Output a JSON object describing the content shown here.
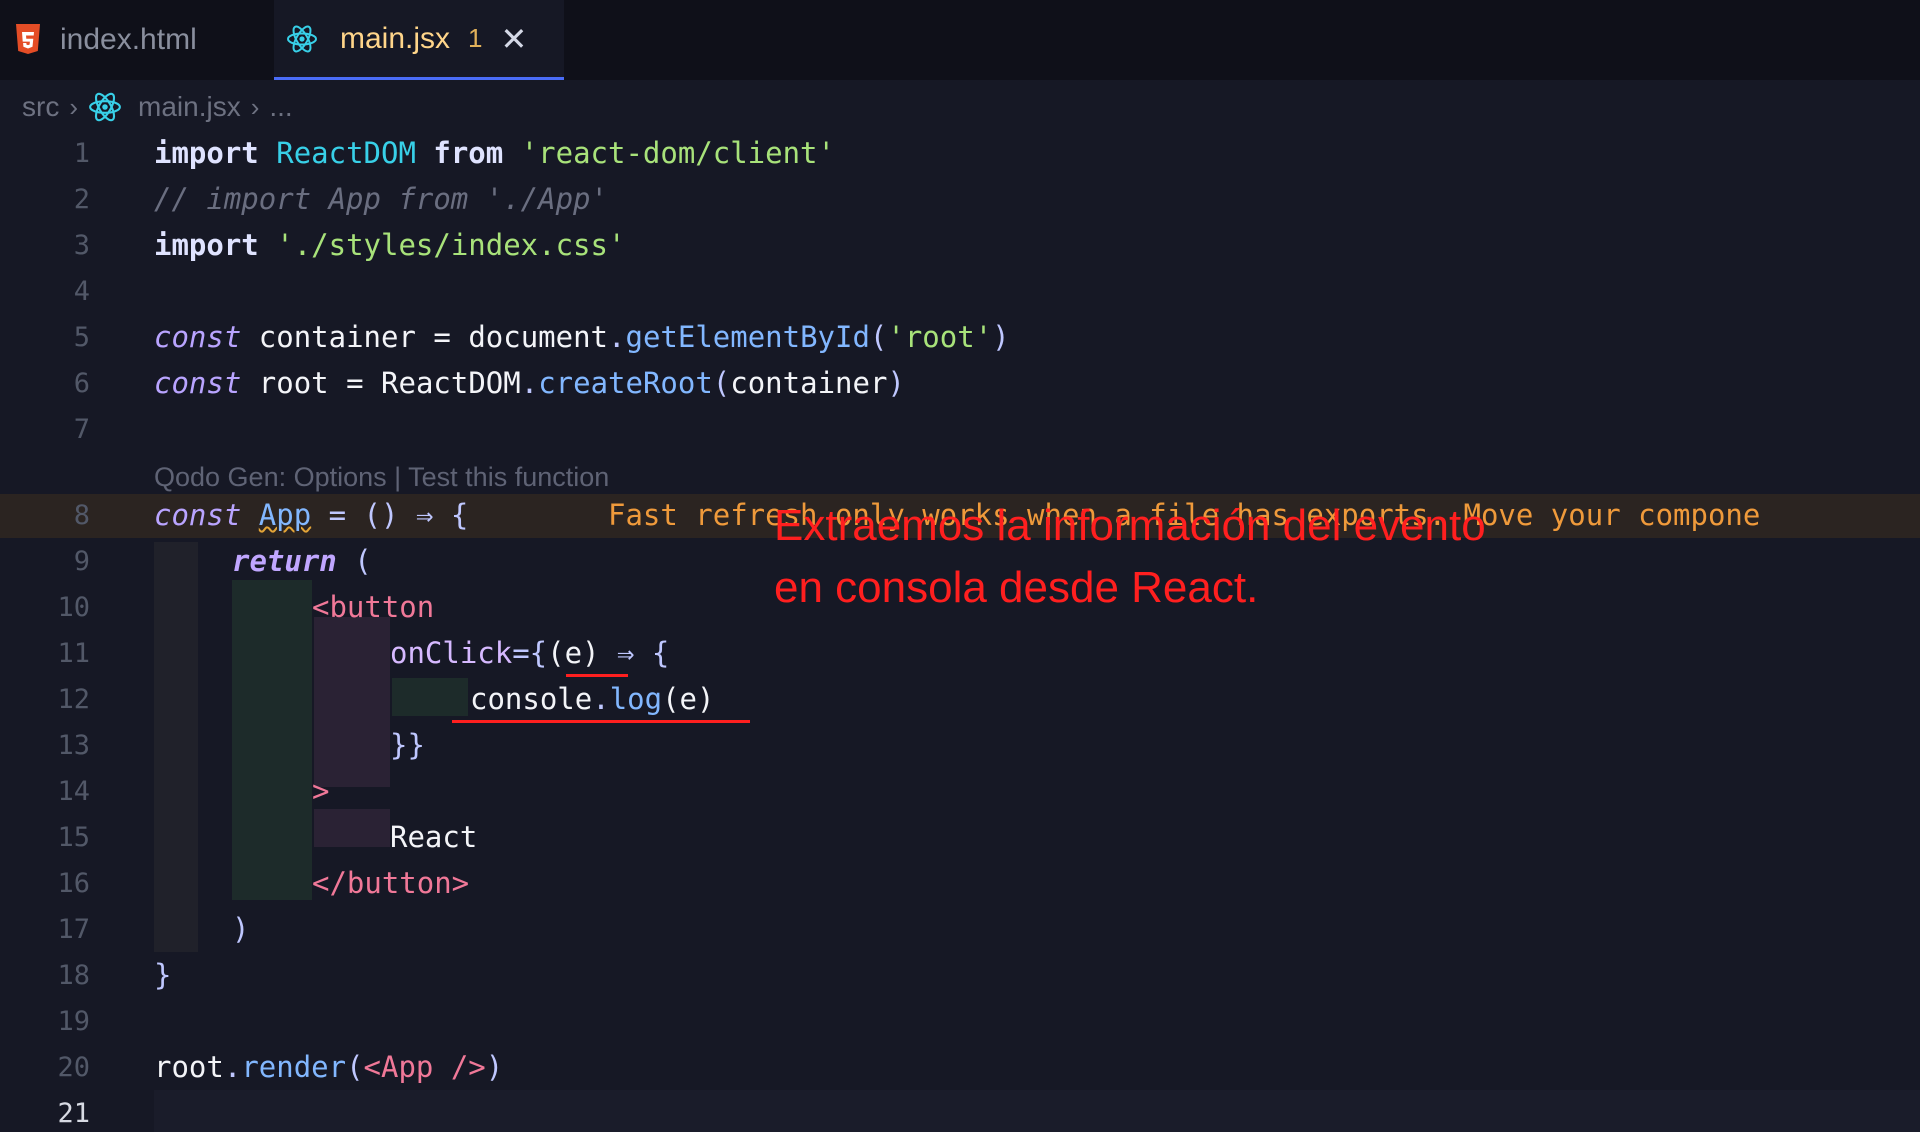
{
  "tabs": [
    {
      "label": "index.html",
      "icon": "html5-icon"
    },
    {
      "label": "main.jsx",
      "icon": "react-icon",
      "problems": "1",
      "close": "✕"
    }
  ],
  "breadcrumb": {
    "folder": "src",
    "file": "main.jsx",
    "more": "..."
  },
  "codelens": "Qodo Gen: Options | Test this function",
  "warning": "Fast refresh only works when a file has exports. Move your compone",
  "line_numbers": [
    "1",
    "2",
    "3",
    "4",
    "5",
    "6",
    "7",
    "8",
    "9",
    "10",
    "11",
    "12",
    "13",
    "14",
    "15",
    "16",
    "17",
    "18",
    "19",
    "20",
    "21"
  ],
  "code": {
    "l1": {
      "kw": "import",
      "name": "ReactDOM",
      "from": "from",
      "path": "'react-dom/client'"
    },
    "l2": {
      "comment": "// import App from './App'"
    },
    "l3": {
      "kw": "import",
      "path": "'./styles/index.css'"
    },
    "l5": {
      "const": "const",
      "name": "container",
      "eq": "=",
      "obj": "document",
      "fn": "getElementById",
      "arg": "'root'"
    },
    "l6": {
      "const": "const",
      "name": "root",
      "eq": "=",
      "obj": "ReactDOM",
      "fn": "createRoot",
      "arg": "container"
    },
    "l8": {
      "const": "const",
      "name": "App",
      "rest": "= () ⇒ {"
    },
    "l9": {
      "ret": "return",
      "paren": "("
    },
    "l10": {
      "tag": "<button"
    },
    "l11": {
      "attr": "onClick",
      "rest1": "={",
      "param": "(e)",
      "arrow": " ⇒ {"
    },
    "l12": {
      "obj": "console",
      "fn": "log",
      "arg": "(e)"
    },
    "l13": {
      "close": "}}"
    },
    "l14": {
      "gt": ">"
    },
    "l15": {
      "text": "React"
    },
    "l16": {
      "tag": "</button>"
    },
    "l17": {
      "paren": ")"
    },
    "l18": {
      "brace": "}"
    },
    "l20": {
      "obj": "root",
      "fn": "render",
      "open": "(",
      "jsx": "<App />",
      "close": ")"
    }
  },
  "annotation": {
    "line1": "Extraemos la información del evento",
    "line2": "en consola desde React."
  },
  "colors": {
    "annotation": "#ff1f1f",
    "warning": "#ef9a3b",
    "accent": "#4a6cf7"
  }
}
